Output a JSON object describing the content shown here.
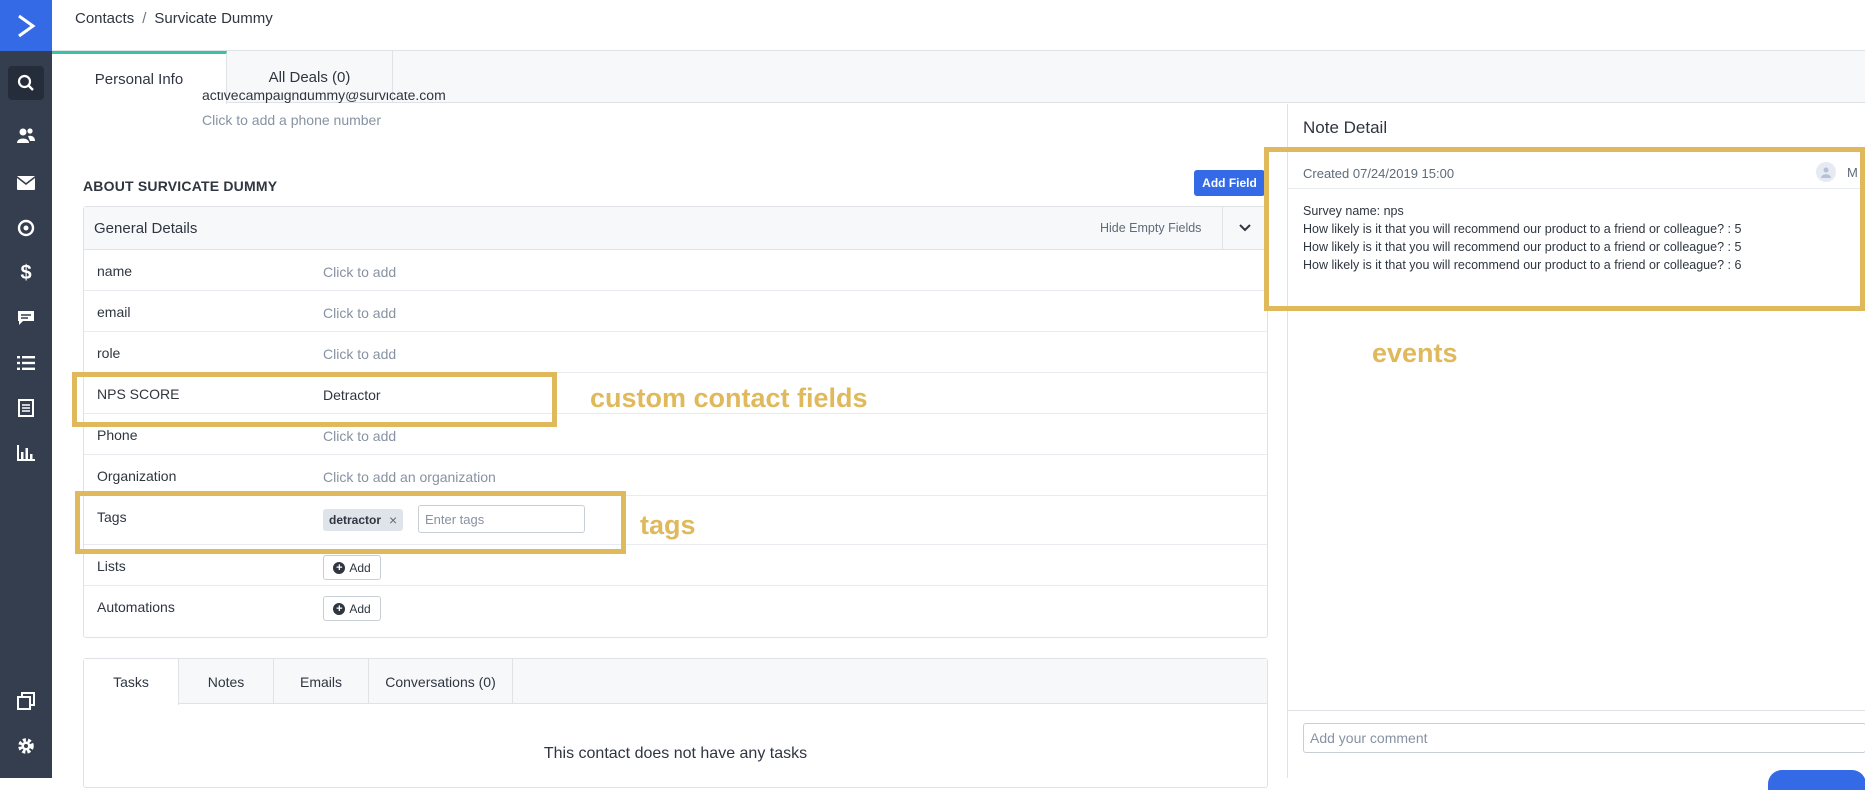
{
  "sidebar": {
    "items": [
      {
        "name": "search",
        "icon": "search-icon"
      },
      {
        "name": "contacts",
        "icon": "contacts-icon"
      },
      {
        "name": "campaigns",
        "icon": "envelope-icon"
      },
      {
        "name": "automations",
        "icon": "target-icon"
      },
      {
        "name": "deals",
        "icon": "dollar-icon"
      },
      {
        "name": "conversations",
        "icon": "chat-icon"
      },
      {
        "name": "lists",
        "icon": "list-icon"
      },
      {
        "name": "forms",
        "icon": "document-icon"
      },
      {
        "name": "reports",
        "icon": "bar-chart-icon"
      },
      {
        "name": "pages",
        "icon": "pages-icon"
      },
      {
        "name": "settings",
        "icon": "gear-icon"
      }
    ],
    "accent": "#356ae6",
    "background": "#353e4e"
  },
  "breadcrumb": {
    "root": "Contacts",
    "separator": "/",
    "current": "Survicate Dummy"
  },
  "profile_tabs": {
    "personal": "Personal Info",
    "deals": "All Deals (0)"
  },
  "contact": {
    "email": "activecampaigndummy@survicate.com",
    "phone_placeholder": "Click to add a phone number"
  },
  "about": {
    "title": "ABOUT SURVICATE DUMMY",
    "add_field": "Add Field",
    "section_title": "General Details",
    "hide_empty": "Hide Empty Fields",
    "fields": [
      {
        "label": "name",
        "value": "Click to add"
      },
      {
        "label": "email",
        "value": "Click to add"
      },
      {
        "label": "role",
        "value": "Click to add"
      },
      {
        "label": "NPS SCORE",
        "value": "Detractor"
      },
      {
        "label": "Phone",
        "value": "Click to add"
      },
      {
        "label": "Organization",
        "value": "Click to add an organization"
      }
    ],
    "tags": {
      "label": "Tags",
      "chip": "detractor",
      "remove": "×",
      "placeholder": "Enter tags"
    },
    "lists": {
      "label": "Lists",
      "button": "Add"
    },
    "automations": {
      "label": "Automations",
      "button": "Add"
    }
  },
  "activity": {
    "tabs": [
      "Tasks",
      "Notes",
      "Emails",
      "Conversations (0)"
    ],
    "empty": "This contact does not have any tasks"
  },
  "note": {
    "title": "Note Detail",
    "created": "Created 07/24/2019 15:00",
    "user_initial": "M",
    "lines": [
      "Survey name: nps",
      "How likely is it that you will recommend our product to a friend or colleague? : 5",
      "How likely is it that you will recommend our product to a friend or colleague? : 5",
      "How likely is it that you will recommend our product to a friend or colleague? : 6"
    ],
    "comment_placeholder": "Add your comment"
  },
  "annotations": {
    "color": "#dfb95c",
    "custom_fields": "custom contact fields",
    "tags": "tags",
    "events": "events"
  }
}
